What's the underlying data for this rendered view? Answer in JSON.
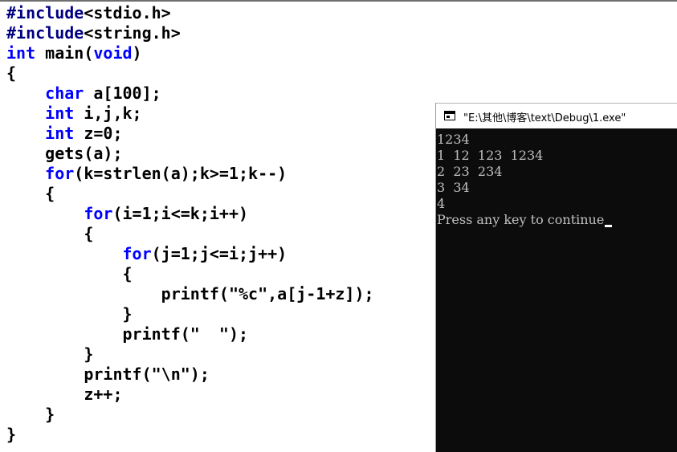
{
  "code_editor": {
    "lines": [
      [
        {
          "t": "#include",
          "k": "preproc"
        },
        {
          "t": "<stdio.h>",
          "k": "plain"
        }
      ],
      [
        {
          "t": "#include",
          "k": "preproc"
        },
        {
          "t": "<string.h>",
          "k": "plain"
        }
      ],
      [
        {
          "t": "int",
          "k": "kw"
        },
        {
          "t": " main(",
          "k": "plain"
        },
        {
          "t": "void",
          "k": "kw"
        },
        {
          "t": ")",
          "k": "plain"
        }
      ],
      [
        {
          "t": "{",
          "k": "plain"
        }
      ],
      [
        {
          "t": "    ",
          "k": "plain"
        },
        {
          "t": "char",
          "k": "kw"
        },
        {
          "t": " a[100];",
          "k": "plain"
        }
      ],
      [
        {
          "t": "    ",
          "k": "plain"
        },
        {
          "t": "int",
          "k": "kw"
        },
        {
          "t": " i,j,k;",
          "k": "plain"
        }
      ],
      [
        {
          "t": "    ",
          "k": "plain"
        },
        {
          "t": "int",
          "k": "kw"
        },
        {
          "t": " z=0;",
          "k": "plain"
        }
      ],
      [
        {
          "t": "    gets(a);",
          "k": "plain"
        }
      ],
      [
        {
          "t": "    ",
          "k": "plain"
        },
        {
          "t": "for",
          "k": "kw"
        },
        {
          "t": "(k=strlen(a);k>=1;k--)",
          "k": "plain"
        }
      ],
      [
        {
          "t": "    {",
          "k": "plain"
        }
      ],
      [
        {
          "t": "        ",
          "k": "plain"
        },
        {
          "t": "for",
          "k": "kw"
        },
        {
          "t": "(i=1;i<=k;i++)",
          "k": "plain"
        }
      ],
      [
        {
          "t": "        {",
          "k": "plain"
        }
      ],
      [
        {
          "t": "            ",
          "k": "plain"
        },
        {
          "t": "for",
          "k": "kw"
        },
        {
          "t": "(j=1;j<=i;j++)",
          "k": "plain"
        }
      ],
      [
        {
          "t": "            {",
          "k": "plain"
        }
      ],
      [
        {
          "t": "                printf(\"%c\",a[j-1+z]);",
          "k": "plain"
        }
      ],
      [
        {
          "t": "            }",
          "k": "plain"
        }
      ],
      [
        {
          "t": "            printf(\"  \");",
          "k": "plain"
        }
      ],
      [
        {
          "t": "        }",
          "k": "plain"
        }
      ],
      [
        {
          "t": "        printf(\"\\n\");",
          "k": "plain"
        }
      ],
      [
        {
          "t": "        z++;",
          "k": "plain"
        }
      ],
      [
        {
          "t": "    }",
          "k": "plain"
        }
      ],
      [
        {
          "t": "}",
          "k": "plain"
        }
      ]
    ]
  },
  "console": {
    "title": "\"E:\\其他\\博客\\text\\Debug\\1.exe\"",
    "icon": "console-window-icon",
    "output_lines": [
      "1234",
      "1  12  123  1234",
      "2  23  234",
      "3  34",
      "4",
      "Press any key to continue"
    ]
  },
  "colors": {
    "preproc": "#000080",
    "keyword": "#0000ff",
    "plain": "#000000",
    "console_bg": "#0c0c0c",
    "console_text": "#c0c0c0"
  }
}
